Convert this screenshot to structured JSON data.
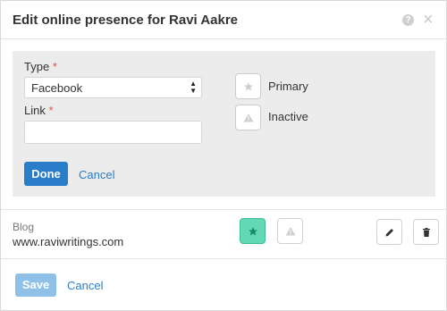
{
  "modal": {
    "title": "Edit online presence for Ravi Aakre",
    "close_glyph": "×",
    "help_glyph": "?"
  },
  "form": {
    "type_label": "Type",
    "required_mark": "*",
    "type_value": "Facebook",
    "link_label": "Link",
    "link_value": "",
    "primary_label": "Primary",
    "inactive_label": "Inactive",
    "done_label": "Done",
    "cancel_label": "Cancel"
  },
  "entries": [
    {
      "type": "Blog",
      "url": "www.raviwritings.com",
      "primary": true,
      "inactive": false
    }
  ],
  "footer": {
    "save_label": "Save",
    "cancel_label": "Cancel"
  },
  "colors": {
    "accent": "#2a7dc9",
    "primary_active": "#62d8b4",
    "required": "#d9534f"
  }
}
